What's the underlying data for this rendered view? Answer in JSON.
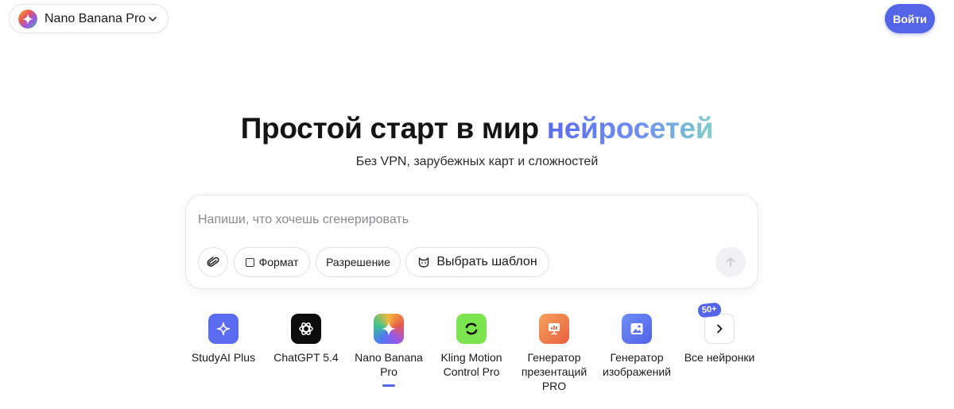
{
  "header": {
    "model_name": "Nano Banana Pro",
    "login_label": "Войти"
  },
  "hero": {
    "title_main": "Простой старт в мир ",
    "title_accent": "нейросетей",
    "subtitle": "Без VPN, зарубежных карт и сложностей"
  },
  "prompt": {
    "placeholder": "Напиши, что хочешь сгенерировать",
    "value": "",
    "chips": {
      "format": "Формат",
      "resolution": "Разрешение",
      "template": "Выбрать шаблон"
    }
  },
  "tools": [
    {
      "label": "StudyAI Plus",
      "icon": "sparkle-icon"
    },
    {
      "label": "ChatGPT 5.4",
      "icon": "openai-icon"
    },
    {
      "label": "Nano Banana Pro",
      "icon": "gemini-sparkle-icon",
      "selected": true
    },
    {
      "label": "Kling Motion Control Pro",
      "icon": "kling-icon"
    },
    {
      "label": "Генератор презентаций PRO",
      "icon": "presentation-icon"
    },
    {
      "label": "Генератор изображений",
      "icon": "image-icon"
    },
    {
      "label": "Все нейронки",
      "icon": "chevron-right-icon",
      "badge": "50+"
    }
  ],
  "colors": {
    "accent": "#5565e8",
    "title_gradient_start": "#5b6cf0",
    "title_gradient_end": "#7ed0c6"
  }
}
